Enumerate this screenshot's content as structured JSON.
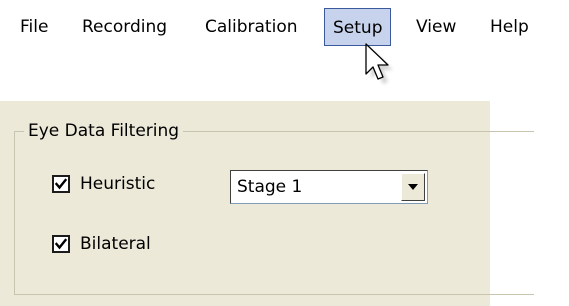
{
  "menubar": {
    "items": [
      {
        "label": "File"
      },
      {
        "label": "Recording"
      },
      {
        "label": "Calibration"
      },
      {
        "label": "Setup",
        "active": true
      },
      {
        "label": "View"
      },
      {
        "label": "Help"
      }
    ]
  },
  "filtering": {
    "title": "Eye Data Filtering",
    "heuristic": {
      "label": "Heuristic",
      "checked": true
    },
    "bilateral": {
      "label": "Bilateral",
      "checked": true
    },
    "stage_select": {
      "value": "Stage 1"
    }
  },
  "icons": {
    "cursor": "arrow-pointer-icon",
    "checkmark": "check-icon",
    "dropdown": "chevron-down-icon"
  }
}
